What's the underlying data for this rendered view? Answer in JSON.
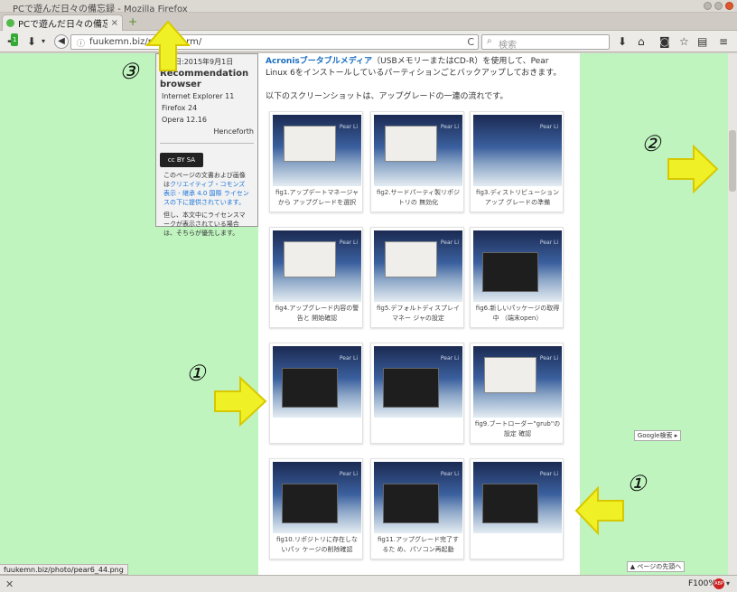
{
  "window": {
    "title": "PCで遊んだ日々の備忘録 - Mozilla Firefox"
  },
  "tab": {
    "title": "PCで遊んだ日々の備忘...",
    "close": "×",
    "new_tab": "+"
  },
  "nav": {
    "url": "fuukemn.biz/pear6-farm/",
    "reload": "C",
    "search_placeholder": "検索",
    "icons": [
      "addon-notification-icon",
      "download-icon",
      "back-icon",
      "reload-icon",
      "search-icon",
      "downloads-icon",
      "home-icon",
      "pocket-icon",
      "bookmark-star-icon",
      "reading-list-icon",
      "menu-icon"
    ],
    "addon_badge": "1"
  },
  "sidebar": {
    "updated": "更新日:2015年9月1日",
    "heading": "Recommendation browser",
    "browsers": [
      "Internet Explorer 11",
      "Firefox 24",
      "Opera 12.16"
    ],
    "henceforth": "Henceforth",
    "cc_badge": "cc BY SA",
    "license_pre": "このページの文書および画像は",
    "license_link": "クリエイティブ・コモンズ 表示 - 継承 4.0 国際 ライセンスの下に提供されています。",
    "license_note": "但し、本文中にライセンスマークが表示されている場合は、そちらが優先します。"
  },
  "main": {
    "intro_bold": "Acronisブータブルメディア",
    "intro_rest": "（USBメモリーまたはCD-R）を使用して、Pear Linux 6をインストールしているパーティションごとバックアップしておきます。",
    "intro2": "以下のスクリーンショットは、アップグレードの一連の流れです。",
    "screen_label": "Pear Li",
    "figures": [
      {
        "caption": "fig1.アップデートマネージャから アップグレードを選択",
        "shot": "window"
      },
      {
        "caption": "fig2.サードパーティ製リポジトリの 無効化",
        "shot": "window"
      },
      {
        "caption": "fig3.ディストリビューションアップ グレードの準備",
        "shot": "plain"
      },
      {
        "caption": "fig4.アップグレード内容の警告と 開始確認",
        "shot": "window"
      },
      {
        "caption": "fig5.デフォルトディスプレイマネー ジャの設定",
        "shot": "window"
      },
      {
        "caption": "fig6.新しいパッケージの取得中 （端末open）",
        "shot": "terminal"
      },
      {
        "caption": "",
        "shot": "terminal"
      },
      {
        "caption": "",
        "shot": "terminal"
      },
      {
        "caption": "fig9.ブートローダー\"grub\"の設定 確認",
        "shot": "window"
      },
      {
        "caption": "fig10.リポジトリに存在しないパッ ケージの削除確認",
        "shot": "terminal"
      },
      {
        "caption": "fig11.アップグレード完了するた め、パソコン再起動",
        "shot": "terminal"
      },
      {
        "caption": "",
        "shot": "terminal"
      }
    ],
    "google_search": "Google検索 ▸",
    "to_top": "▲ ページの先頭へ"
  },
  "status": {
    "link": "fuukemn.biz/photo/pear6_44.png",
    "zoom": "F100%",
    "abp": "ABP"
  },
  "annotations": {
    "label1": "①",
    "label2": "②",
    "label3": "③",
    "arrow_color": "#f0f026"
  }
}
